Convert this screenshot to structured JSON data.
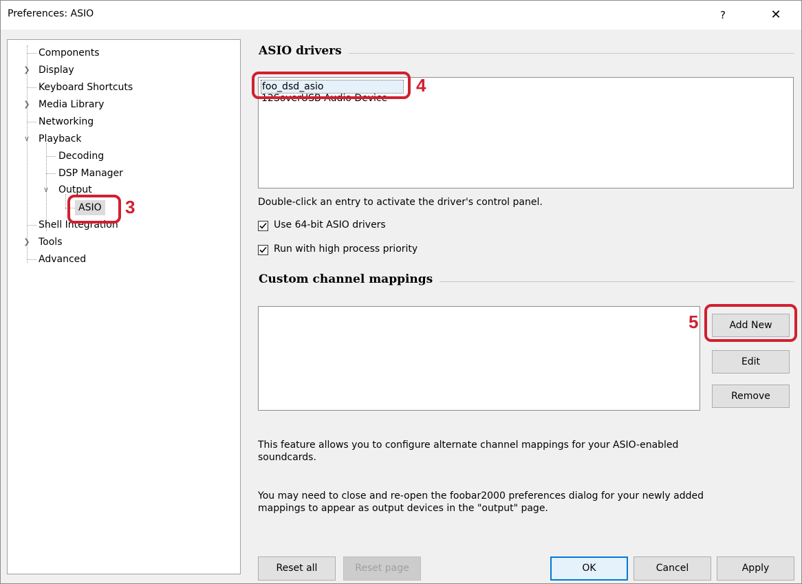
{
  "window": {
    "title": "Preferences: ASIO",
    "help_glyph": "?",
    "close_glyph": "✕"
  },
  "tree": {
    "items": [
      {
        "label": "Components"
      },
      {
        "label": "Display"
      },
      {
        "label": "Keyboard Shortcuts"
      },
      {
        "label": "Media Library"
      },
      {
        "label": "Networking"
      },
      {
        "label": "Playback"
      },
      {
        "label": "Decoding"
      },
      {
        "label": "DSP Manager"
      },
      {
        "label": "Output"
      },
      {
        "label": "ASIO",
        "selected": true
      },
      {
        "label": "Shell Integration"
      },
      {
        "label": "Tools"
      },
      {
        "label": "Advanced"
      }
    ]
  },
  "annotations": [
    "3",
    "4",
    "5"
  ],
  "asio": {
    "section_title": "ASIO drivers",
    "drivers": [
      "foo_dsd_asio",
      "12SoverUSB Audio Device"
    ],
    "hint": "Double-click an entry to activate the driver's control panel.",
    "use64": {
      "label": "Use 64-bit ASIO drivers",
      "checked": true
    },
    "highprio": {
      "label": "Run with high process priority",
      "checked": true
    }
  },
  "mappings": {
    "section_title": "Custom channel mappings",
    "add_label": "Add New",
    "edit_label": "Edit",
    "remove_label": "Remove",
    "desc1": "This feature allows you to configure alternate channel mappings for your ASIO-enabled soundcards.",
    "desc2": "You may need to close and re-open the foobar2000 preferences dialog for your newly added mappings to appear as output devices in the \"output\" page."
  },
  "footer": {
    "reset_all": "Reset all",
    "reset_page": "Reset page",
    "ok": "OK",
    "cancel": "Cancel",
    "apply": "Apply"
  },
  "colors": {
    "annotation": "#d02030",
    "selection": "#dcdcdc",
    "focus": "#0078d7"
  }
}
